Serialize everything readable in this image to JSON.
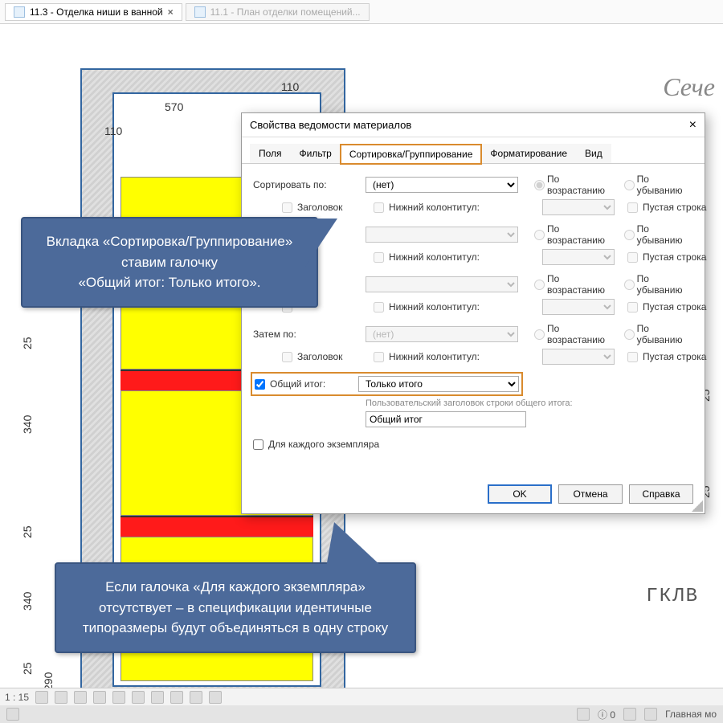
{
  "tabs": {
    "active": "11.3 - Отделка ниши в ванной",
    "inactive": "11.1 - План отделки помещений..."
  },
  "drawing": {
    "dims": {
      "top1": "570",
      "top_right": "110",
      "top_left": "110",
      "left1": "25",
      "left2": "340",
      "left3": "25",
      "left4": "340",
      "left5": "25",
      "left6": "290",
      "right1": "25",
      "right2": "25"
    },
    "label_right": "ГКЛВ",
    "section_label": "Сече"
  },
  "dialog": {
    "title": "Свойства ведомости материалов",
    "tabs": {
      "fields": "Поля",
      "filter": "Фильтр",
      "sort": "Сортировка/Группирование",
      "format": "Форматирование",
      "view": "Вид"
    },
    "sort_by_label": "Сортировать по:",
    "sort_none": "(нет)",
    "asc": "По возрастанию",
    "desc": "По убыванию",
    "header_label": "Заголовок",
    "footer_label": "Нижний колонтитул:",
    "blank_line": "Пустая строка",
    "then_by": "Затем по:",
    "grand_total_label": "Общий итог:",
    "grand_total_value": "Только итого",
    "custom_total_label": "Пользовательский заголовок строки общего итога:",
    "custom_total_value": "Общий итог",
    "each_instance": "Для каждого экземпляра",
    "buttons": {
      "ok": "OK",
      "cancel": "Отмена",
      "help": "Справка"
    }
  },
  "callouts": {
    "c1_l1": "Вкладка «Сортировка/Группирование»",
    "c1_l2": "ставим галочку",
    "c1_l3": "«Общий итог: Только итого».",
    "c2_l1": "Если галочка «Для каждого экземпляра»",
    "c2_l2": "отсутствует – в спецификации идентичные",
    "c2_l3": "типоразмеры будут объединяться в одну строку"
  },
  "status": {
    "scale": "1 : 15",
    "zoom_val": "0",
    "main": "Главная мо"
  }
}
